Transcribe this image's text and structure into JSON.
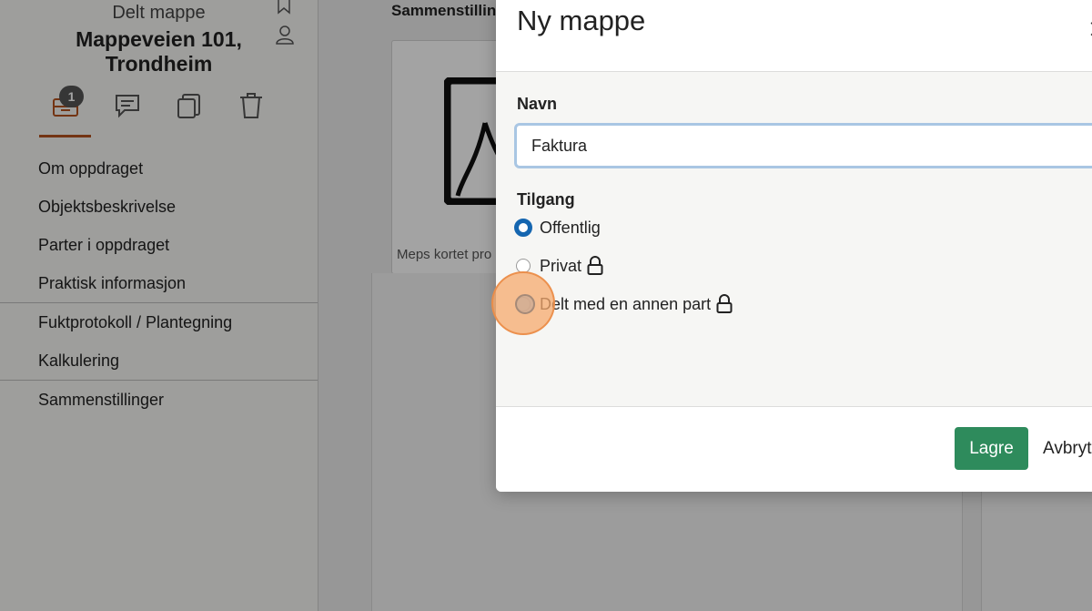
{
  "sidebar": {
    "folder_type": "Delt mappe",
    "folder_title": "Mappeveien 101, Trondheim",
    "badge_count": "1",
    "nav_items": [
      {
        "label": "Om oppdraget"
      },
      {
        "label": "Objektsbeskrivelse"
      },
      {
        "label": "Parter i oppdraget"
      },
      {
        "label": "Praktisk informasjon"
      },
      {
        "label": "Fuktprotokoll / Plantegning"
      },
      {
        "label": "Kalkulering"
      },
      {
        "label": "Sammenstillinger"
      }
    ],
    "icons": [
      "bookmark-icon",
      "user-icon",
      "archive-icon",
      "comment-icon",
      "copy-icon",
      "trash-icon"
    ],
    "accent_color": "#b4521f"
  },
  "main": {
    "heading": "Sammenstillin",
    "card_caption": "Meps kortet pro"
  },
  "modal": {
    "title": "Ny mappe",
    "name_label": "Navn",
    "name_value": "Faktura",
    "access_label": "Tilgang",
    "options": [
      {
        "label": "Offentlig",
        "selected": true,
        "locked": false
      },
      {
        "label": "Privat",
        "selected": false,
        "locked": true
      },
      {
        "label": "Delt med en annen part",
        "selected": false,
        "locked": true
      }
    ],
    "save_label": "Lagre",
    "cancel_label": "Avbryt",
    "colors": {
      "primary": "#2e8b5c",
      "radio_selected": "#1566b0",
      "input_focus": "#a9c6e3"
    }
  }
}
